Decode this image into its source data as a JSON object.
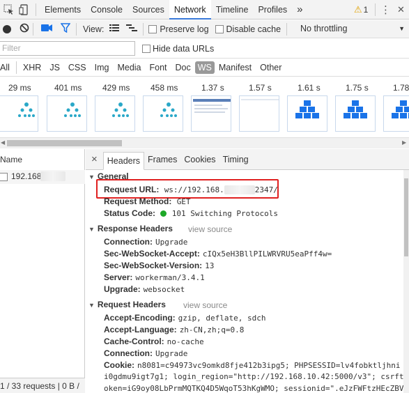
{
  "toolbar": {
    "tabs": [
      "Elements",
      "Console",
      "Sources",
      "Network",
      "Timeline",
      "Profiles"
    ],
    "active_tab": "Network",
    "more": "»",
    "warning_count": "1",
    "warning_icon": "⚠",
    "menu": "⋮",
    "close": "✕"
  },
  "network_toolbar": {
    "view_label": "View:",
    "preserve_log": "Preserve log",
    "disable_cache": "Disable cache",
    "throttle": "No throttling"
  },
  "filter": {
    "placeholder": "Filter",
    "hide_data_urls": "Hide data URLs"
  },
  "types": [
    "All",
    "XHR",
    "JS",
    "CSS",
    "Img",
    "Media",
    "Font",
    "Doc",
    "WS",
    "Manifest",
    "Other"
  ],
  "active_type": "WS",
  "filmstrip": {
    "times": [
      "29 ms",
      "401 ms",
      "429 ms",
      "458 ms",
      "1.37 s",
      "1.57 s",
      "1.61 s",
      "1.75 s",
      "1.78"
    ]
  },
  "request_list": {
    "header": "Name",
    "item": "192.168",
    "status": "1 / 33 requests | 0 B /"
  },
  "details": {
    "close": "×",
    "tabs": [
      "Headers",
      "Frames",
      "Cookies",
      "Timing"
    ],
    "active_tab": "Headers",
    "general": {
      "title": "General",
      "url_key": "Request URL:",
      "url_value_a": "ws://192.168.",
      "url_value_b": "2347/",
      "method_key": "Request Method:",
      "method_value": "GET",
      "status_key": "Status Code:",
      "status_value": "101 Switching Protocols",
      "status_color": "#1da827"
    },
    "response": {
      "title": "Response Headers",
      "view_source": "view source",
      "rows": [
        {
          "k": "Connection:",
          "v": "Upgrade"
        },
        {
          "k": "Sec-WebSocket-Accept:",
          "v": "cIQx5eH3BllPILWRVRU5eaPff4w="
        },
        {
          "k": "Sec-WebSocket-Version:",
          "v": "13"
        },
        {
          "k": "Server:",
          "v": "workerman/3.4.1"
        },
        {
          "k": "Upgrade:",
          "v": "websocket"
        }
      ]
    },
    "request": {
      "title": "Request Headers",
      "view_source": "view source",
      "rows": [
        {
          "k": "Accept-Encoding:",
          "v": "gzip, deflate, sdch"
        },
        {
          "k": "Accept-Language:",
          "v": "zh-CN,zh;q=0.8"
        },
        {
          "k": "Cache-Control:",
          "v": "no-cache"
        },
        {
          "k": "Connection:",
          "v": "Upgrade"
        },
        {
          "k": "Cookie:",
          "v": "n8081=c94973vc9omkd8fje412b3ipg5; PHPSESSID=lv4fobktljhni"
        }
      ],
      "cookie_cont1": "i0gdmu9igt7g1; login_region=\"http://192.168.10.42:5000/v3\"; csrft",
      "cookie_cont2": "oken=iG9oy08LbPrmMQTKQ4D5WqoT53hKgWMO; sessionid=\".eJzFWFtzHEcZBV"
    }
  }
}
